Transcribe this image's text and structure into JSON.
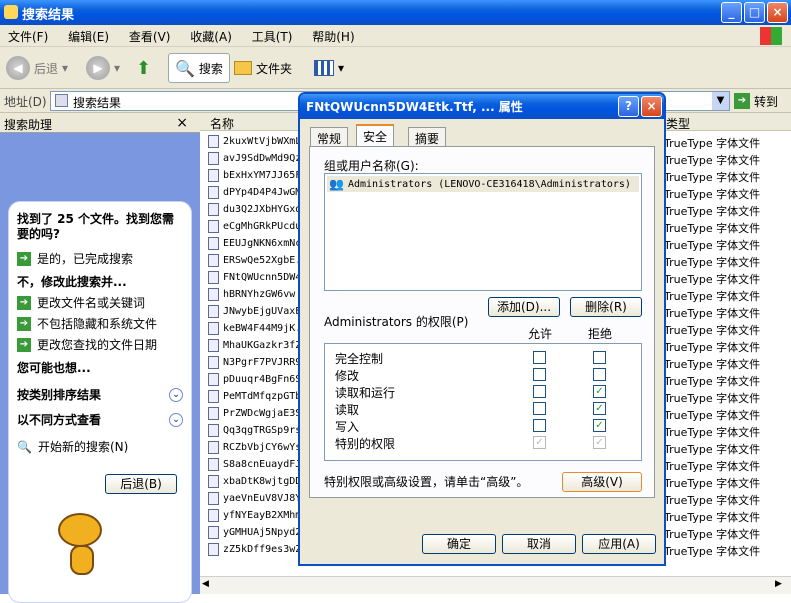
{
  "window": {
    "title": "搜索结果"
  },
  "menu": [
    "文件(F)",
    "编辑(E)",
    "查看(V)",
    "收藏(A)",
    "工具(T)",
    "帮助(H)"
  ],
  "toolbar": {
    "back": "后退",
    "search": "搜索",
    "folders": "文件夹"
  },
  "address": {
    "label": "地址(D)",
    "value": "搜索结果",
    "go": "转到"
  },
  "assistant": {
    "title": "搜索助理",
    "found": "找到了 25 个文件。找到您需要的吗?",
    "yes": "是的，已完成搜索",
    "no_heading": "不，修改此搜索并...",
    "options": [
      "更改文件名或关键词",
      "不包括隐藏和系统文件",
      "更改您查找的文件日期"
    ],
    "also": "您可能也想...",
    "sort": "按类别排序结果",
    "view": "以不同方式查看",
    "new_search": "开始新的搜索(N)",
    "back": "后退(B)"
  },
  "files": {
    "col_name": "名称",
    "col_type": "类型",
    "names": [
      "2kuxWtVjbWXmL",
      "avJ9SdDwMd9Qz",
      "bExHxYM7JJ65F",
      "dPYp4D4P4JwGM",
      "du3Q2JXbHYGxd",
      "eCgMhGRkPUcdu",
      "EEUJgNKN6xmNc",
      "ERSwQe52XgbE.",
      "FNtQWUcnn5DW4",
      "hBRNYhzGW6vw",
      "JNwybEjgUVaxE",
      "keBW4F44M9jK.",
      "MhaUKGazkr3fZ",
      "N3PgrF7PVJRR9",
      "pDuuqr4BgFn6S",
      "PeMTdMfqzpGTb",
      "PrZWDcWgjaE3S",
      "Qq3qgTRGSp9rs",
      "RCZbVbjCY6wYs",
      "S8a8cnEuaydFJ",
      "xbaDtK8wjtgDD",
      "yaeVnEuV8VJ8Y",
      "yfNYEayB2XMhm",
      "yGMHUAj5Npyd2",
      "zZ5kDff9es3wZ"
    ],
    "type_text": "TrueType 字体文件"
  },
  "dialog": {
    "title": "FNtQWUcnn5DW4Etk.Ttf, ... 属性",
    "tabs": [
      "常规",
      "安全",
      "摘要"
    ],
    "group_label": "组或用户名称(G):",
    "user": "Administrators (LENOVO-CE316418\\Administrators)",
    "add": "添加(D)...",
    "remove": "删除(R)",
    "perm_label": "Administrators 的权限(P)",
    "allow": "允许",
    "deny": "拒绝",
    "permissions": [
      {
        "name": "完全控制",
        "allow": false,
        "deny": false,
        "dim": false
      },
      {
        "name": "修改",
        "allow": false,
        "deny": false,
        "dim": false
      },
      {
        "name": "读取和运行",
        "allow": false,
        "deny": true,
        "dim": false
      },
      {
        "name": "读取",
        "allow": false,
        "deny": true,
        "dim": false
      },
      {
        "name": "写入",
        "allow": false,
        "deny": true,
        "dim": false
      },
      {
        "name": "特别的权限",
        "allow": true,
        "deny": true,
        "dim": true
      }
    ],
    "advanced_note": "特别权限或高级设置，请单击“高级”。",
    "advanced": "高级(V)",
    "ok": "确定",
    "cancel": "取消",
    "apply": "应用(A)"
  }
}
